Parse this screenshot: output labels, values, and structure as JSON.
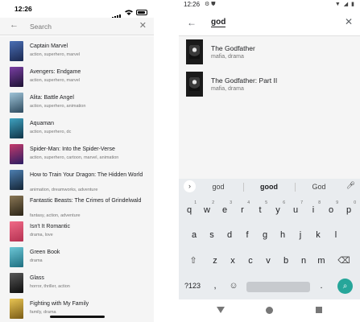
{
  "ios": {
    "time": "12:26",
    "search": {
      "placeholder": "Search"
    },
    "items": [
      {
        "title": "Captain Marvel",
        "tags": "action, superhero, marvel",
        "poster_color": "#2a3f73"
      },
      {
        "title": "Avengers: Endgame",
        "tags": "action, superhero, marvel",
        "poster_color": "#3b2459"
      },
      {
        "title": "Alita: Battle Angel",
        "tags": "action, superhero, animation",
        "poster_color": "#4a6f8a"
      },
      {
        "title": "Aquaman",
        "tags": "action, superhero, dc",
        "poster_color": "#1f5f7a"
      },
      {
        "title": "Spider-Man: Into the Spider-Verse",
        "tags": "action, superhero, cartoon, marvel, animation",
        "poster_color": "#5a3ca0"
      },
      {
        "title": "How to Train Your Dragon: The Hidden World",
        "tags": "animation, dreamworks, adventure",
        "poster_color": "#2c4a66"
      },
      {
        "title": "Fantastic Beasts: The Crimes of Grindelwald",
        "tags": "fantasy, action, adventure",
        "poster_color": "#6b5a3a"
      },
      {
        "title": "Isn't It Romantic",
        "tags": "drama, love",
        "poster_color": "#d94f6a"
      },
      {
        "title": "Green Book",
        "tags": "drama",
        "poster_color": "#3e9fb2"
      },
      {
        "title": "Glass",
        "tags": "horror, thriller, action",
        "poster_color": "#2d2d2d"
      },
      {
        "title": "Fighting with My Family",
        "tags": "family, drama",
        "poster_color": "#c7a23a"
      }
    ]
  },
  "android": {
    "time": "12:26",
    "search": {
      "query": "god"
    },
    "results": [
      {
        "title": "The Godfather",
        "tags": "mafia, drama"
      },
      {
        "title": "The Godfather: Part II",
        "tags": "mafia, drama"
      }
    ],
    "keyboard": {
      "suggestions": [
        "god",
        "good",
        "God"
      ],
      "row1": [
        "q",
        "w",
        "e",
        "r",
        "t",
        "y",
        "u",
        "i",
        "o",
        "p"
      ],
      "row1_hints": [
        "1",
        "2",
        "3",
        "4",
        "5",
        "6",
        "7",
        "8",
        "9",
        "0"
      ],
      "row2": [
        "a",
        "s",
        "d",
        "f",
        "g",
        "h",
        "j",
        "k",
        "l"
      ],
      "row3": [
        "z",
        "x",
        "c",
        "v",
        "b",
        "n",
        "m"
      ],
      "symbols_key": "?123",
      "comma_key": ",",
      "period_key": "."
    }
  }
}
